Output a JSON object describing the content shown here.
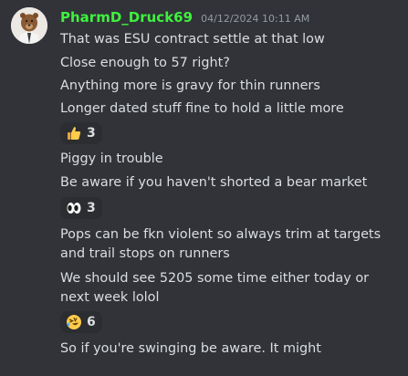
{
  "author": {
    "username": "PharmD_Druck69",
    "timestamp": "04/12/2024 10:11 AM"
  },
  "messages": [
    "That was ESU contract settle at that low",
    "Close enough to 57 right?",
    "Anything more is gravy for thin runners",
    "Longer dated stuff fine to hold a little more",
    "Piggy in trouble",
    "Be aware if you haven't shorted a bear market",
    "Pops can be fkn violent so always trim at targets and trail stops on runners",
    "We should see 5205 some time either today or next week lolol",
    "So if you're swinging be aware. It might"
  ],
  "reactions": [
    {
      "icon": "thumbs-up-icon",
      "count": "3"
    },
    {
      "icon": "eyes-icon",
      "count": "3"
    },
    {
      "icon": "rofl-icon",
      "count": "6"
    }
  ],
  "colors": {
    "background": "#313338",
    "username": "#3ff03f",
    "text": "#dbdee1",
    "timestamp": "#949ba4",
    "reaction_bg": "#2b2d31"
  }
}
